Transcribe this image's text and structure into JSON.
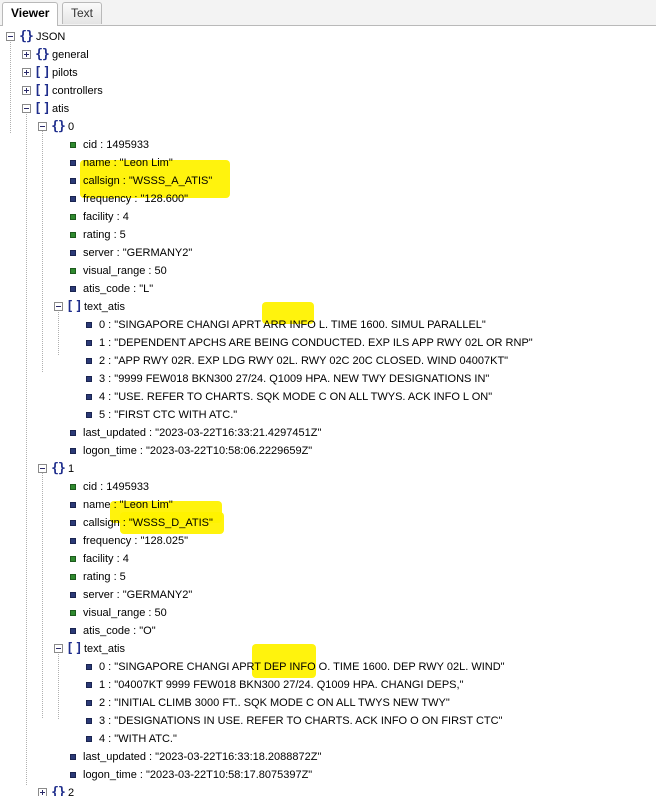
{
  "tabs": [
    "Viewer",
    "Text"
  ],
  "root": "JSON",
  "top_keys": [
    "general",
    "pilots",
    "controllers",
    "atis"
  ],
  "atis0": {
    "index": "0",
    "cid": "cid : 1495933",
    "name": "name : \"Leon Lim\"",
    "callsign": "callsign : \"WSSS_A_ATIS\"",
    "frequency": "frequency : \"128.600\"",
    "facility": "facility : 4",
    "rating": "rating : 5",
    "server": "server : \"GERMANY2\"",
    "visual_range": "visual_range : 50",
    "atis_code": "atis_code : \"L\"",
    "text_atis_key": "text_atis",
    "text_atis": [
      "0 : \"SINGAPORE CHANGI APRT ARR INFO L. TIME 1600. SIMUL PARALLEL\"",
      "1 : \"DEPENDENT APCHS ARE BEING CONDUCTED. EXP ILS APP RWY 02L OR RNP\"",
      "2 : \"APP RWY 02R. EXP LDG RWY 02L. RWY 02C 20C CLOSED. WIND 04007KT\"",
      "3 : \"9999 FEW018 BKN300 27/24. Q1009 HPA. NEW TWY DESIGNATIONS IN\"",
      "4 : \"USE. REFER TO CHARTS. SQK MODE C ON ALL TWYS. ACK INFO L ON\"",
      "5 : \"FIRST CTC WITH ATC.\""
    ],
    "last_updated": "last_updated : \"2023-03-22T16:33:21.4297451Z\"",
    "logon_time": "logon_time : \"2023-03-22T10:58:06.2229659Z\""
  },
  "atis1": {
    "index": "1",
    "cid": "cid : 1495933",
    "name": "name : \"Leon Lim\"",
    "callsign": "callsign : \"WSSS_D_ATIS\"",
    "frequency": "frequency : \"128.025\"",
    "facility": "facility : 4",
    "rating": "rating : 5",
    "server": "server : \"GERMANY2\"",
    "visual_range": "visual_range : 50",
    "atis_code": "atis_code : \"O\"",
    "text_atis_key": "text_atis",
    "text_atis": [
      "0 : \"SINGAPORE CHANGI APRT DEP INFO O. TIME 1600. DEP RWY 02L. WIND\"",
      "1 : \"04007KT 9999 FEW018 BKN300 27/24. Q1009 HPA. CHANGI DEPS,\"",
      "2 : \"INITIAL CLIMB 3000 FT.. SQK MODE C ON ALL TWYS NEW TWY\"",
      "3 : \"DESIGNATIONS IN USE. REFER TO CHARTS. ACK INFO O ON FIRST CTC\"",
      "4 : \"WITH ATC.\""
    ],
    "last_updated": "last_updated : \"2023-03-22T16:33:18.2088872Z\"",
    "logon_time": "logon_time : \"2023-03-22T10:58:17.8075397Z\""
  },
  "atis2_index": "2",
  "colors": {
    "highlight": "#fff200",
    "number_bullet": "#2f8a2f",
    "string_bullet": "#2b3a77",
    "icon": "#1e2d8c"
  }
}
